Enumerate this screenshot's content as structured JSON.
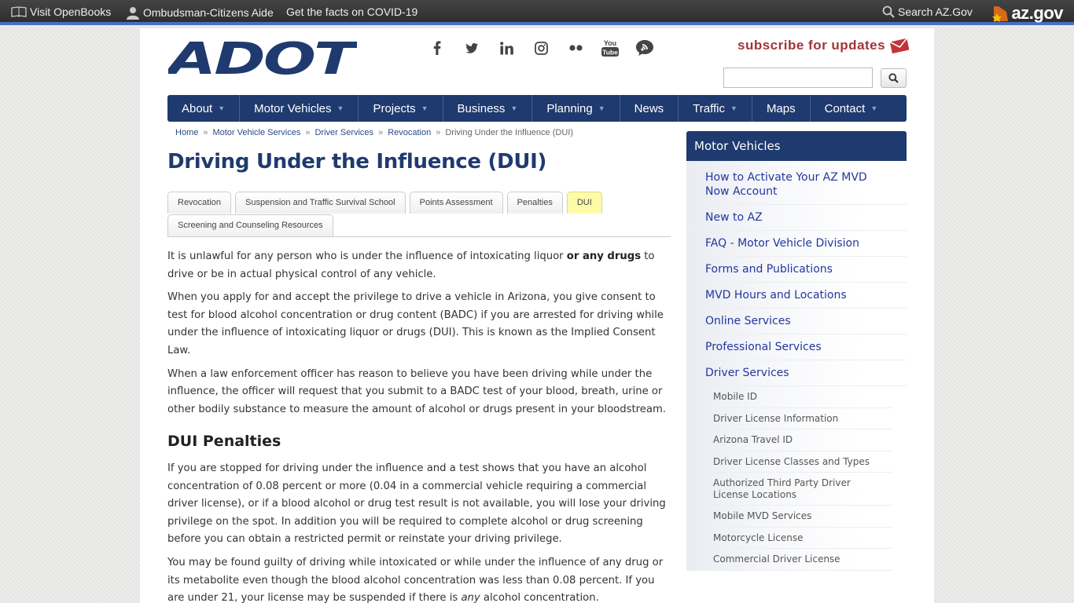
{
  "topbar": {
    "openbooks": "Visit OpenBooks",
    "ombudsman": "Ombudsman-Citizens Aide",
    "covid": "Get the facts on COVID-19",
    "search": "Search AZ.Gov",
    "azgov": "az.gov"
  },
  "header": {
    "logo_text": "ADOT",
    "subscribe": "subscribe for updates",
    "social": [
      "facebook",
      "twitter",
      "linkedin",
      "instagram",
      "flickr",
      "youtube",
      "blog"
    ],
    "youtube_label": "You Tube"
  },
  "nav": {
    "items": [
      {
        "label": "About",
        "dropdown": true
      },
      {
        "label": "Motor Vehicles",
        "dropdown": true
      },
      {
        "label": "Projects",
        "dropdown": true
      },
      {
        "label": "Business",
        "dropdown": true
      },
      {
        "label": "Planning",
        "dropdown": true
      },
      {
        "label": "News",
        "dropdown": false
      },
      {
        "label": "Traffic",
        "dropdown": true
      },
      {
        "label": "Maps",
        "dropdown": false
      },
      {
        "label": "Contact",
        "dropdown": true
      }
    ]
  },
  "breadcrumb": {
    "items": [
      "Home",
      "Motor Vehicle Services",
      "Driver Services",
      "Revocation"
    ],
    "current": "Driving Under the Influence (DUI)",
    "separator": "»"
  },
  "page_title": "Driving Under the Influence (DUI)",
  "tabs": {
    "row1": [
      "Revocation",
      "Suspension and Traffic Survival School",
      "Points Assessment",
      "Penalties",
      "DUI"
    ],
    "row2": [
      "Screening and Counseling Resources"
    ],
    "active": "DUI"
  },
  "content": {
    "p1_a": "It is unlawful for any person who is under the influence of intoxicating liquor ",
    "p1_b": "or any drugs",
    "p1_c": " to drive or be in actual physical control of any vehicle.",
    "p2": "When you apply for and accept the privilege to drive a vehicle in Arizona, you give consent to test for blood alcohol concentration or drug content (BADC) if you are arrested for driving while under the influence of intoxicating liquor or drugs (DUI). This is known as the Implied Consent Law.",
    "p3": "When a law enforcement officer has reason to believe you have been driving while under the influence, the officer will request that you submit to a BADC test of your blood, breath, urine or other bodily substance to measure the amount of alcohol or drugs present in your bloodstream.",
    "h2": "DUI Penalties",
    "p4": "If you are stopped for driving under the influence and a test shows that you have an alcohol concentration of 0.08 percent or more (0.04 in a commercial vehicle requiring a commercial driver license), or if a blood alcohol or drug test result is not available, you will lose your driving privilege on the spot. In addition you will be required to complete alcohol or drug screening before you can obtain a restricted permit or reinstate your driving privilege.",
    "p5_a": "You may be found guilty of driving while intoxicated or while under the influence of any drug or its metabolite even though the blood alcohol concentration was less than 0.08 percent. If you are under 21, your license may be suspended if there is ",
    "p5_b": "any",
    "p5_c": " alcohol concentration."
  },
  "sidebar": {
    "heading": "Motor Vehicles",
    "items": [
      "How to Activate Your AZ MVD Now Account",
      "New to AZ",
      "FAQ - Motor Vehicle Division",
      "Forms and Publications",
      "MVD Hours and Locations",
      "Online Services",
      "Professional Services",
      "Driver Services"
    ],
    "sub_items": [
      "Mobile ID",
      "Driver License Information",
      "Arizona Travel ID",
      "Driver License Classes and Types",
      "Authorized Third Party Driver License Locations",
      "Mobile MVD Services",
      "Motorcycle License",
      "Commercial Driver License"
    ]
  },
  "colors": {
    "nav_bg": "#1f3a6e",
    "link": "#2237a0",
    "active_tab": "#fdfba8",
    "subscribe": "#a2343a"
  }
}
